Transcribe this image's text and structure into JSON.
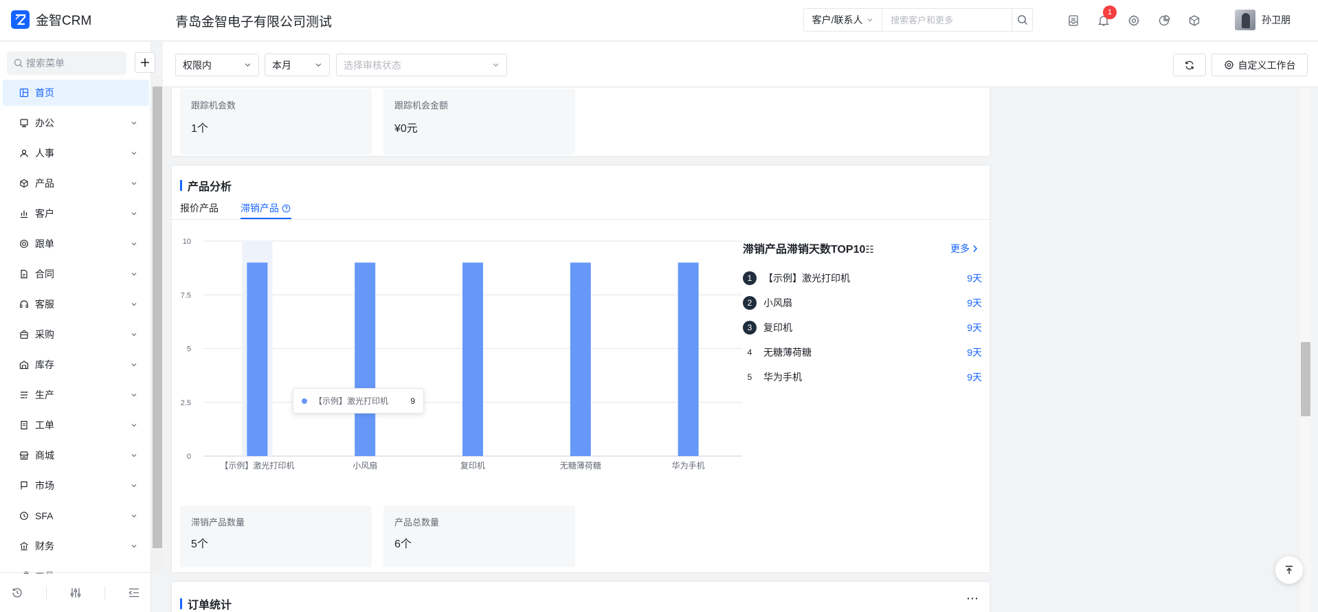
{
  "header": {
    "app_name": "金智CRM",
    "company": "青岛金智电子有限公司测试",
    "search_type": "客户/联系人",
    "search_placeholder": "搜索客户和更多",
    "notification_count": "1",
    "user_name": "孙卫朋"
  },
  "sidebar": {
    "search_placeholder": "搜索菜单",
    "items": [
      {
        "label": "首页",
        "icon": "dashboard-icon",
        "active": true
      },
      {
        "label": "办公",
        "icon": "office-icon"
      },
      {
        "label": "人事",
        "icon": "people-icon"
      },
      {
        "label": "产品",
        "icon": "cube-icon"
      },
      {
        "label": "客户",
        "icon": "chart-bar-icon"
      },
      {
        "label": "跟单",
        "icon": "target-icon"
      },
      {
        "label": "合同",
        "icon": "document-icon"
      },
      {
        "label": "客服",
        "icon": "headset-icon"
      },
      {
        "label": "采购",
        "icon": "bag-icon"
      },
      {
        "label": "库存",
        "icon": "warehouse-icon"
      },
      {
        "label": "生产",
        "icon": "factory-icon"
      },
      {
        "label": "工单",
        "icon": "ticket-icon"
      },
      {
        "label": "商城",
        "icon": "shop-icon"
      },
      {
        "label": "市场",
        "icon": "flag-icon"
      },
      {
        "label": "SFA",
        "icon": "sfa-icon"
      },
      {
        "label": "财务",
        "icon": "finance-icon"
      },
      {
        "label": "工具",
        "icon": "tool-icon"
      }
    ]
  },
  "filters": {
    "scope": "权限内",
    "period": "本月",
    "audit_placeholder": "选择审核状态",
    "customize_label": "自定义工作台"
  },
  "opportunity": {
    "count_label": "跟踪机会数",
    "count_value": "1个",
    "amount_label": "跟踪机会金额",
    "amount_value": "¥0元"
  },
  "product_analysis": {
    "title": "产品分析",
    "tabs": [
      "报价产品",
      "滞销产品"
    ],
    "active_tab": 1,
    "rank_title": "滞销产品滞销天数TOP10",
    "more_label": "更多",
    "ranking": [
      {
        "rank": "1",
        "name": "【示例】激光打印机",
        "value": "9天"
      },
      {
        "rank": "2",
        "name": "小风扇",
        "value": "9天"
      },
      {
        "rank": "3",
        "name": "复印机",
        "value": "9天"
      },
      {
        "rank": "4",
        "name": "无糖薄荷糖",
        "value": "9天"
      },
      {
        "rank": "5",
        "name": "华为手机",
        "value": "9天"
      }
    ],
    "tooltip": {
      "name": "【示例】激光打印机",
      "value": "9"
    },
    "stats": [
      {
        "label": "滞销产品数量",
        "value": "5个"
      },
      {
        "label": "产品总数量",
        "value": "6个"
      }
    ]
  },
  "order_stats": {
    "title": "订单统计"
  },
  "chart_data": {
    "type": "bar",
    "categories": [
      "【示例】激光打印机",
      "小风扇",
      "复印机",
      "无糖薄荷糖",
      "华为手机"
    ],
    "values": [
      9,
      9,
      9,
      9,
      9
    ],
    "ylim": [
      0,
      10
    ],
    "yticks": [
      0,
      2.5,
      5,
      7.5,
      10
    ],
    "ytick_labels": [
      "0",
      "2.5",
      "5",
      "7.5",
      "10"
    ],
    "grid": true,
    "color": "#6698f9",
    "highlight_index": 0
  }
}
